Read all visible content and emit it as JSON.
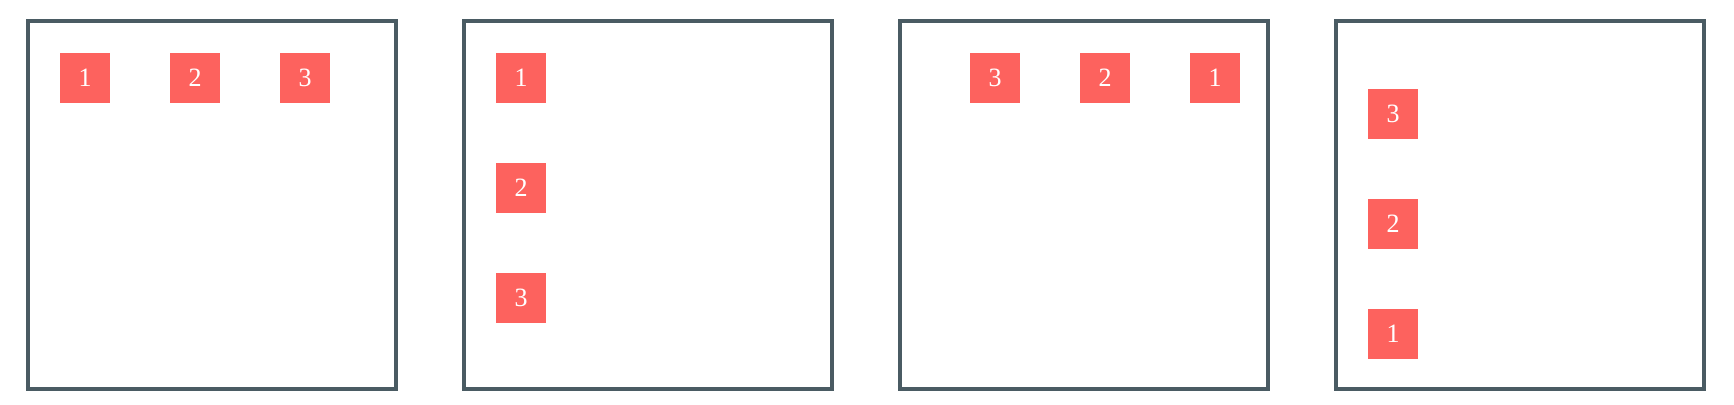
{
  "colors": {
    "frame": "#4a5b63",
    "item": "#fd625e",
    "item_text": "#ffffff"
  },
  "panels": [
    {
      "items": [
        "1",
        "2",
        "3"
      ]
    },
    {
      "items": [
        "1",
        "2",
        "3"
      ]
    },
    {
      "items": [
        "1",
        "2",
        "3"
      ]
    },
    {
      "items": [
        "1",
        "2",
        "3"
      ]
    }
  ]
}
